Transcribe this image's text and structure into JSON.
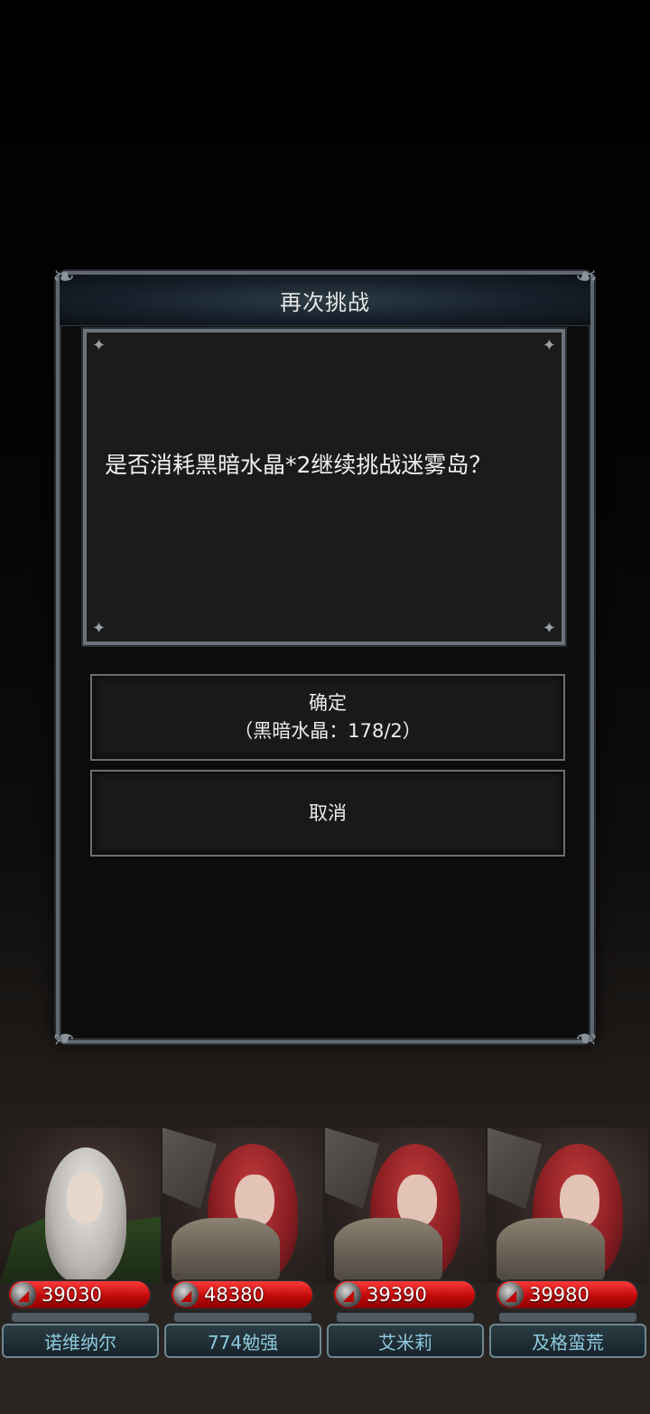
{
  "dialog": {
    "title": "再次挑战",
    "message": "是否消耗黑暗水晶*2继续挑战迷雾岛？",
    "confirm_label": "确定",
    "confirm_cost": "（黑暗水晶：178/2）",
    "cancel_label": "取消"
  },
  "heroes": [
    {
      "power": "39030",
      "name": "诺维纳尔"
    },
    {
      "power": "48380",
      "name": "774勉强"
    },
    {
      "power": "39390",
      "name": "艾米莉"
    },
    {
      "power": "39980",
      "name": "及格蛮荒"
    }
  ],
  "colors": {
    "power_bar": "#c10a0a",
    "name_text": "#8ec9de",
    "dialog_border": "#5f6770"
  }
}
